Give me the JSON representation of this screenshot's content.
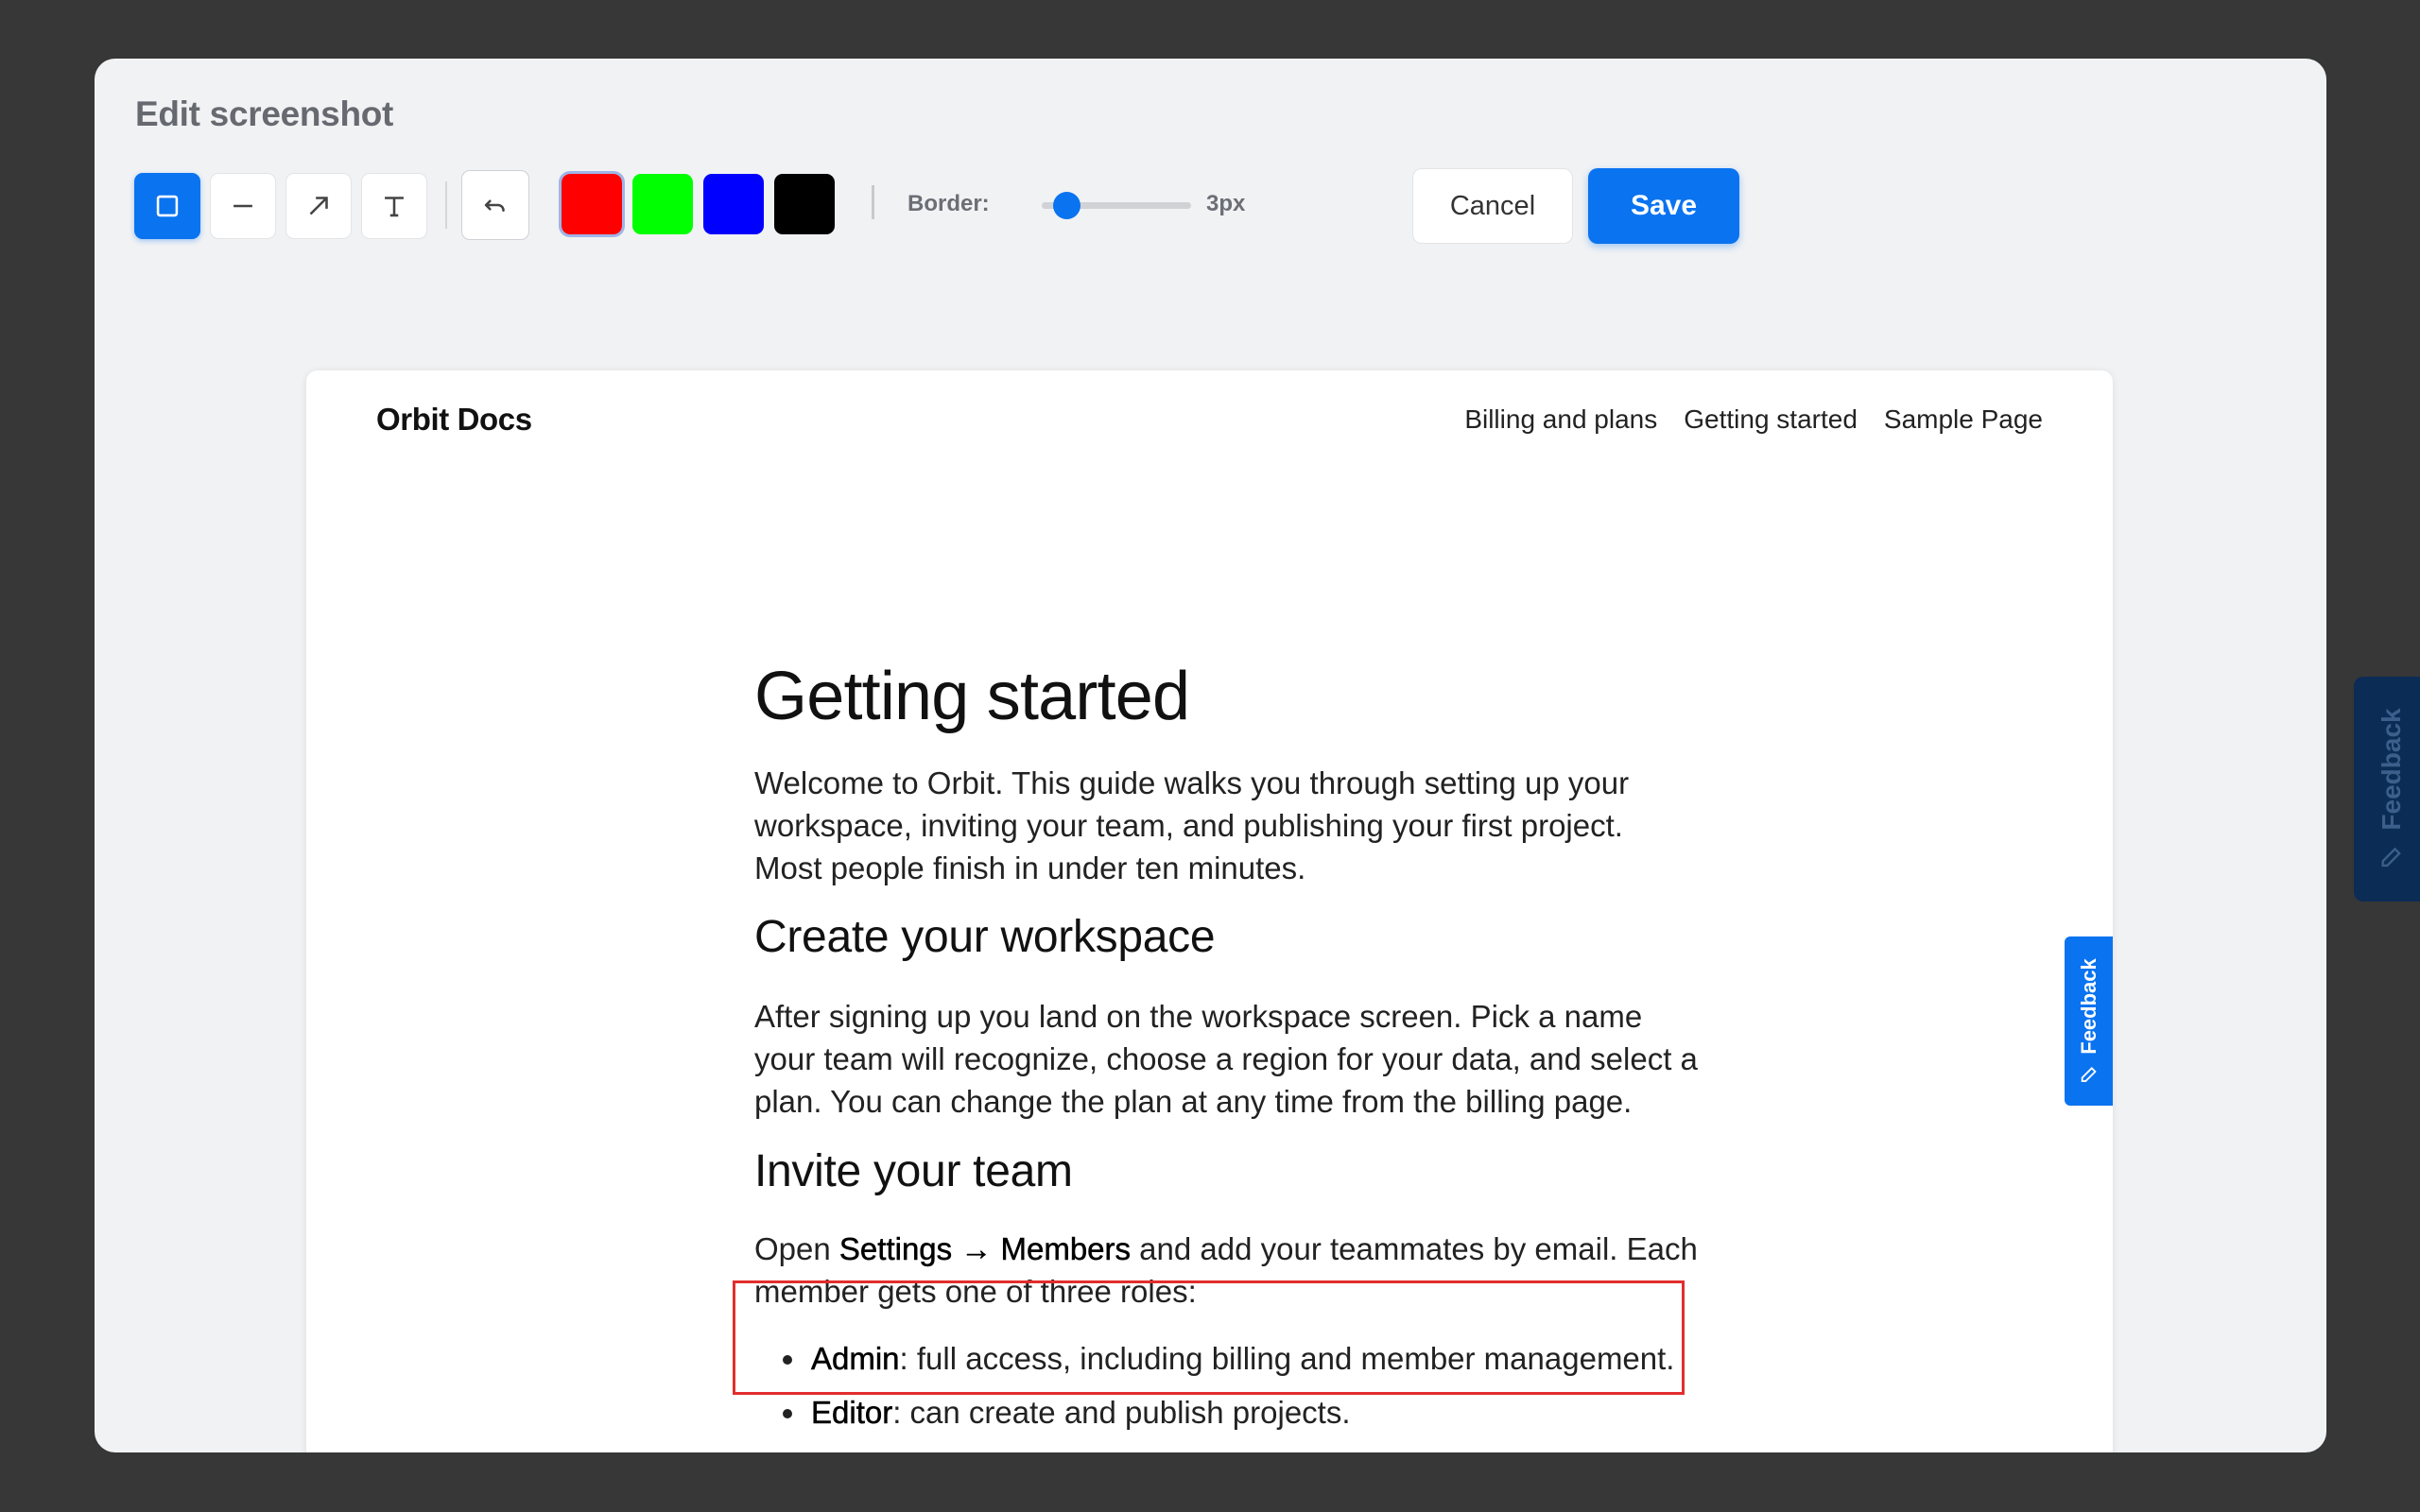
{
  "modal": {
    "title": "Edit screenshot"
  },
  "toolbar": {
    "tools": [
      {
        "name": "rectangle",
        "icon": "square-icon",
        "active": true
      },
      {
        "name": "line",
        "icon": "line-icon",
        "active": false
      },
      {
        "name": "arrow",
        "icon": "arrow-icon",
        "active": false
      },
      {
        "name": "text",
        "icon": "text-icon",
        "active": false
      }
    ],
    "undo_icon": "undo-icon",
    "colors": [
      {
        "name": "red",
        "hex": "#ff0000",
        "selected": true
      },
      {
        "name": "green",
        "hex": "#00ff00",
        "selected": false
      },
      {
        "name": "blue",
        "hex": "#0000ff",
        "selected": false
      },
      {
        "name": "black",
        "hex": "#000000",
        "selected": false
      }
    ],
    "border_label": "Border:",
    "border_value": "3px",
    "border_level": 0.17,
    "cancel_label": "Cancel",
    "save_label": "Save"
  },
  "preview": {
    "site_name": "Orbit Docs",
    "nav": [
      "Billing and plans",
      "Getting started",
      "Sample Page"
    ],
    "article": {
      "title": "Getting started",
      "intro": "Welcome to Orbit. This guide walks you through setting up your workspace, inviting your team, and publishing your first project. Most people finish in under ten minutes.",
      "section1_title": "Create your workspace",
      "section1_body": "After signing up you land on the workspace screen. Pick a name your team will recognize, choose a region for your data, and select a plan. You can change the plan at any time from the billing page.",
      "section2_title": "Invite your team",
      "section2_open": "Open ",
      "section2_settings": "Settings → Members",
      "section2_rest": " and add your teammates by email. Each member gets one of three roles:",
      "roles": [
        {
          "name": "Admin",
          "desc": ": full access, including billing and member management."
        },
        {
          "name": "Editor",
          "desc": ": can create and publish projects."
        }
      ]
    },
    "feedback_label": "Feedback"
  },
  "background": {
    "feedback_label": "Feedback"
  },
  "colors": {
    "accent": "#0a73f0",
    "annotation": "#e22d2d",
    "backdrop": "#373737"
  }
}
